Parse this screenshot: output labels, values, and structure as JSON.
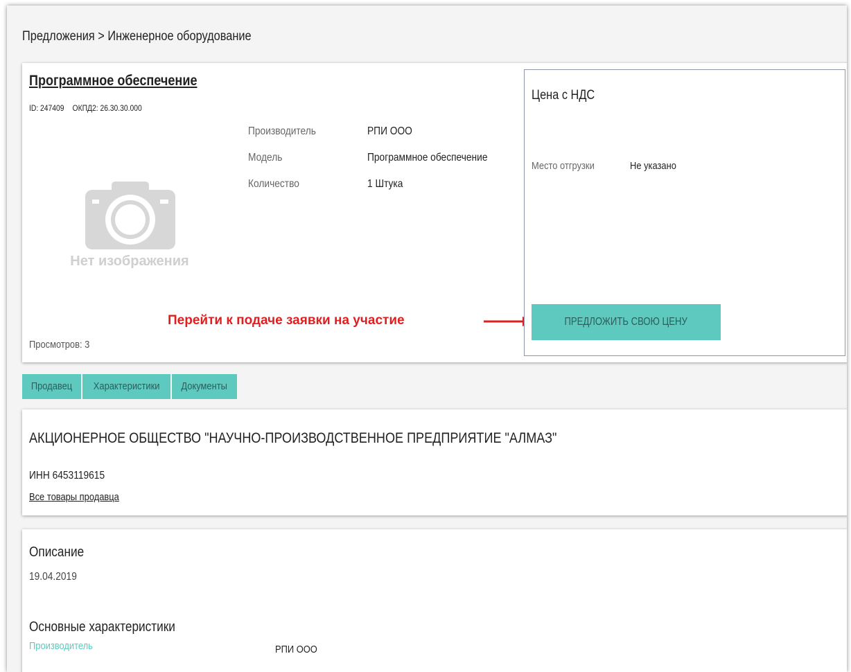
{
  "breadcrumb": "Предложения > Инженерное оборудование",
  "product": {
    "title": "Программное обеспечение",
    "id": "ID: 247409",
    "okpd": "ОКПД2: 26.30.30.000",
    "no_image": "Нет изображения",
    "properties": [
      {
        "label": "Производитель",
        "value": "РПИ ООО"
      },
      {
        "label": "Модель",
        "value": "Программное обеспечение"
      },
      {
        "label": "Количество",
        "value": "1 Штука"
      }
    ],
    "views": "Просмотров: 3"
  },
  "price": {
    "title": "Цена с НДС",
    "ship_label": "Место отгрузки",
    "ship_value": "Не указано",
    "offer_button": "ПРЕДЛОЖИТЬ СВОЮ ЦЕНУ"
  },
  "annotation": "Перейти к подаче заявки на участие",
  "tabs": [
    "Продавец",
    "Характеристики",
    "Документы"
  ],
  "seller": {
    "name": "АКЦИОНЕРНОЕ ОБЩЕСТВО \"НАУЧНО-ПРОИЗВОДСТВЕННОЕ ПРЕДПРИЯТИЕ \"АЛМАЗ\"",
    "inn": "ИНН 6453119615",
    "all_goods_link": "Все товары продавца"
  },
  "description": {
    "title": "Описание",
    "date": "19.04.2019",
    "specs_title": "Основные характеристики",
    "specs": [
      {
        "label": "Производитель",
        "value": "РПИ ООО"
      }
    ]
  },
  "colors": {
    "accent": "#5ec9bf",
    "annotation": "#e02020"
  }
}
